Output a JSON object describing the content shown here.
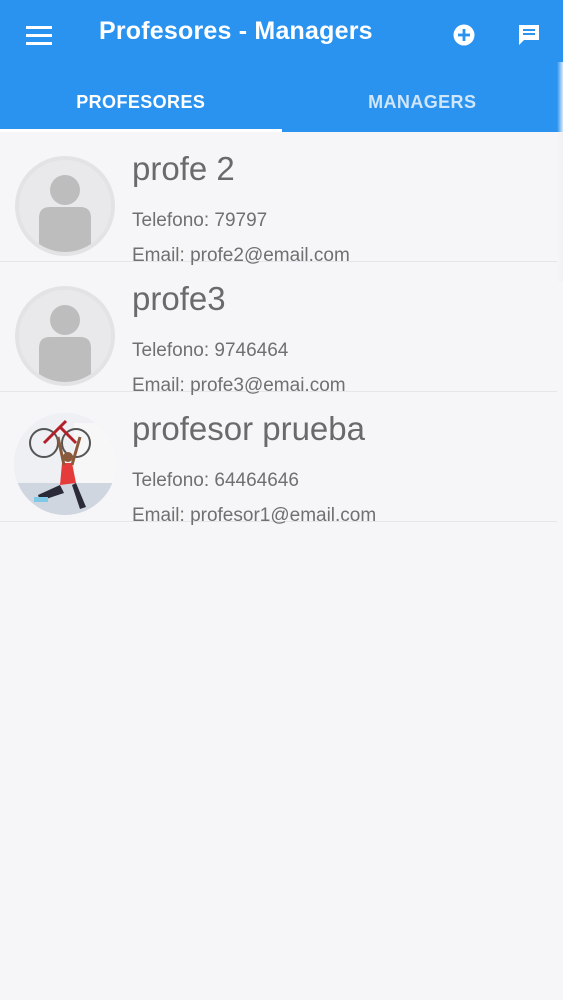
{
  "app": {
    "title": "Profesores - Managers"
  },
  "toolbar": {
    "menu_icon": "menu-icon",
    "add_icon": "add-circle-icon",
    "chat_icon": "chat-icon"
  },
  "tabs": [
    {
      "label": "PROFESORES",
      "active": true
    },
    {
      "label": "MANAGERS",
      "active": false
    }
  ],
  "colors": {
    "primary": "#2a93f0",
    "background": "#f6f6f8",
    "text_secondary": "#707070"
  },
  "professors": [
    {
      "name": "profe 2",
      "phone": "Telefono: 79797",
      "email": "Email: profe2@email.com",
      "avatar": "default-avatar-icon"
    },
    {
      "name": "profe3",
      "phone": "Telefono: 9746464",
      "email": "Email: profe3@emai.com",
      "avatar": "default-avatar-icon"
    },
    {
      "name": "profesor prueba",
      "phone": "Telefono: 64464646",
      "email": "Email: profesor1@email.com",
      "avatar": "photo-avatar"
    }
  ]
}
